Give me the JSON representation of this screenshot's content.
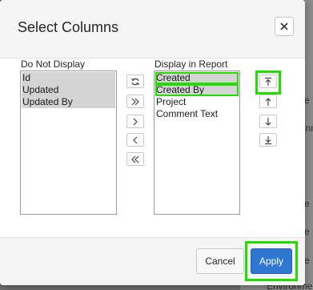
{
  "background": {
    "link_fragment": "ct",
    "texts": [
      "e",
      "onme",
      "e",
      "e",
      "e",
      "Environme",
      "e",
      "Environme"
    ]
  },
  "dialog": {
    "title": "Select Columns",
    "close_icon": "close-icon"
  },
  "left_column": {
    "label": "Do Not Display",
    "items": [
      "Id",
      "Updated",
      "Updated By"
    ]
  },
  "right_column": {
    "label": "Display in Report",
    "items": [
      "Created",
      "Created By",
      "Project",
      "Comment Text"
    ]
  },
  "middle_buttons": {
    "icons": [
      "reset-icon",
      "move-all-right-icon",
      "move-right-icon",
      "move-left-icon",
      "move-all-left-icon"
    ]
  },
  "order_buttons": {
    "icons": [
      "move-top-icon",
      "move-up-icon",
      "move-down-icon",
      "move-bottom-icon"
    ]
  },
  "footer": {
    "cancel_label": "Cancel",
    "apply_label": "Apply"
  },
  "colors": {
    "accent": "#2f77d0",
    "highlight": "#22dd00"
  }
}
